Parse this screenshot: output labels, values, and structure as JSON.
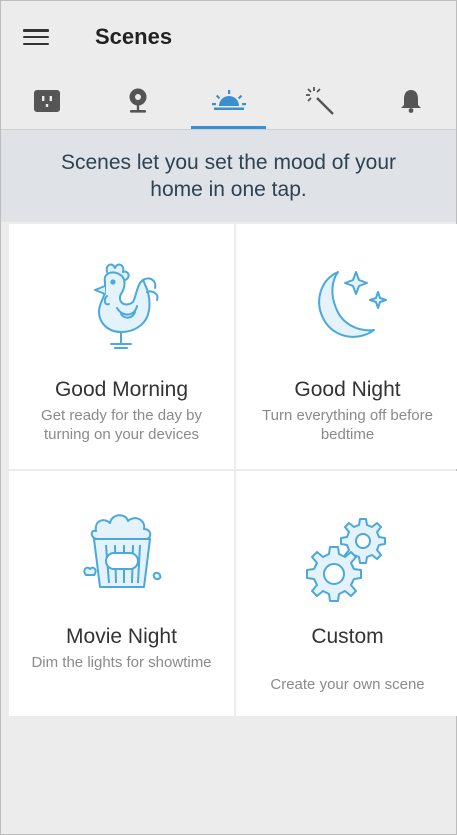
{
  "header": {
    "title": "Scenes",
    "menu_icon": "hamburger-menu-icon"
  },
  "tabs": [
    {
      "icon": "outlet-icon",
      "active": false
    },
    {
      "icon": "camera-icon",
      "active": false
    },
    {
      "icon": "sunrise-icon",
      "active": true
    },
    {
      "icon": "magic-wand-icon",
      "active": false
    },
    {
      "icon": "bell-icon",
      "active": false
    }
  ],
  "banner": {
    "text": "Scenes let you set the mood of your home in one tap."
  },
  "scenes": [
    {
      "name": "Good Morning",
      "description": "Get ready for the day by turning on your devices",
      "icon": "rooster-icon"
    },
    {
      "name": "Good Night",
      "description": "Turn everything off before bedtime",
      "icon": "moon-stars-icon"
    },
    {
      "name": "Movie Night",
      "description": "Dim the lights for showtime",
      "icon": "popcorn-icon"
    },
    {
      "name": "Custom",
      "description": "Create your own scene",
      "icon": "gears-icon"
    }
  ],
  "colors": {
    "accent": "#3a8fcf",
    "icon_stroke": "#4aa8dc",
    "icon_fill": "#e3f2fb",
    "tab_icon": "#555555"
  }
}
